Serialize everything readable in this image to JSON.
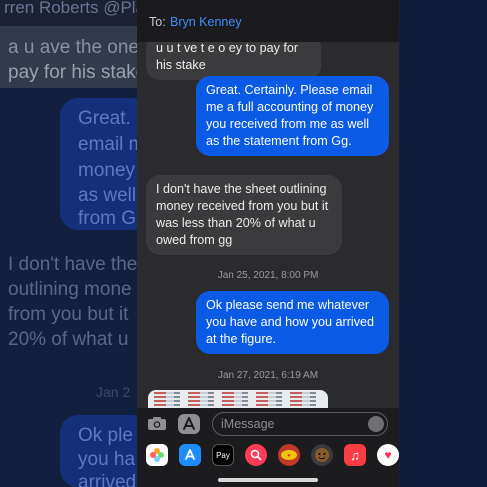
{
  "background": {
    "top_name": "rren Roberts @Play",
    "lines_left_top": [
      "a u  ave the  oney o",
      "pay for his stake"
    ],
    "lines_left_blue": [
      "Great. C",
      "email m",
      "money",
      "as well",
      "from G"
    ],
    "lines_left_reply": [
      "I don't have the",
      "outlining mone",
      "from you but it",
      "20% of what u"
    ],
    "stamp_left": "Jan 2",
    "lines_left_bottom": [
      "Ok ple",
      "you ha",
      "arrived"
    ]
  },
  "header": {
    "to_label": "To:",
    "contact_name": "Bryn Kenney"
  },
  "messages": [
    {
      "dir": "in",
      "text": "u  u  t  ve t e  o ey to pay for his stake"
    },
    {
      "dir": "out",
      "text": "Great. Certainly.  Please email me a full accounting of money you received from me as well as the statement from Gg."
    },
    {
      "dir": "in",
      "text": "I don't have the sheet outlining money received from you but it was less than 20% of what u owed from gg"
    },
    {
      "stamp": "Jan 25, 2021, 8:00 PM"
    },
    {
      "dir": "out",
      "text": "Ok please send me whatever you have and how you arrived at the figure."
    },
    {
      "stamp": "Jan 27, 2021, 6:19 AM"
    }
  ],
  "composer": {
    "placeholder": "iMessage"
  },
  "app_drawer": [
    {
      "icon": "photos-icon",
      "color": "#ffffff"
    },
    {
      "icon": "appstore-icon",
      "color": "#1e8cff"
    },
    {
      "icon": "applepay-icon",
      "label": "Pay",
      "color": "#000000"
    },
    {
      "icon": "search-images-icon",
      "color": "#ff3b57"
    },
    {
      "icon": "avatar-sticker-icon",
      "color": "#c0392b"
    },
    {
      "icon": "memoji-icon",
      "color": "#3a3a3c"
    },
    {
      "icon": "music-icon",
      "color": "#fc3c44"
    },
    {
      "icon": "heart-icon",
      "color": "#ff2d55"
    }
  ],
  "colors": {
    "outgoing_bubble": "#0a5ae6",
    "incoming_bubble": "#3b3b3d",
    "link_blue": "#3d8cff"
  }
}
